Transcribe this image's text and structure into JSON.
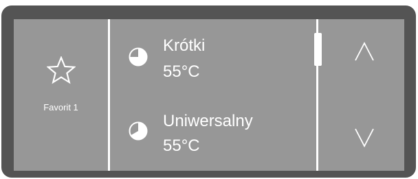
{
  "favorite": {
    "label": "Favorit 1",
    "icon": "star-icon"
  },
  "programs": [
    {
      "name": "Krótki",
      "temperature": "55°C",
      "icon": "pie-clock-icon"
    },
    {
      "name": "Uniwersalny",
      "temperature": "55°C",
      "icon": "pie-clock-icon"
    }
  ],
  "navigation": {
    "up_icon": "chevron-up-icon",
    "down_icon": "chevron-down-icon"
  },
  "colors": {
    "bezel": "#545454",
    "screen": "#979797",
    "foreground": "#ffffff"
  }
}
